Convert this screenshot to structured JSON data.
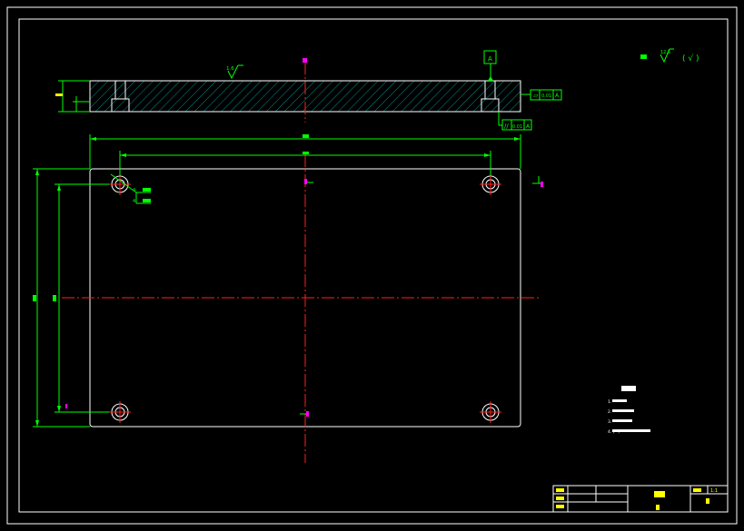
{
  "section_view": {
    "roughness_mark": "1.6",
    "thickness_dim": "",
    "flatness_tolerance": "0.01",
    "flatness_datum": "A",
    "parallel_tolerance": "0.01",
    "parallel_datum": "A",
    "datum_label": "A"
  },
  "plan_view": {
    "overall_width_dim": "",
    "hole_spacing_x_dim": "",
    "overall_height_dim": "",
    "hole_spacing_y_dim": "",
    "hole_callout_1": "4-",
    "hole_callout_2": "4-"
  },
  "surface_note": {
    "label": "",
    "symbol_value": "12.5",
    "symbol_text": "( √ )"
  },
  "tech_requirements": {
    "title": "",
    "lines": [
      "1.",
      "2.",
      "3.",
      "4. (~)"
    ]
  },
  "title_block": {
    "part_name": "",
    "scale": "1:1",
    "drawing_no": ""
  },
  "colors": {
    "outline": "#ffffff",
    "dimension": "#00ff00",
    "centerline": "#ff2020",
    "hatch": "#00b4b4",
    "marker": "#ff00ff",
    "text": "#ffff00"
  }
}
